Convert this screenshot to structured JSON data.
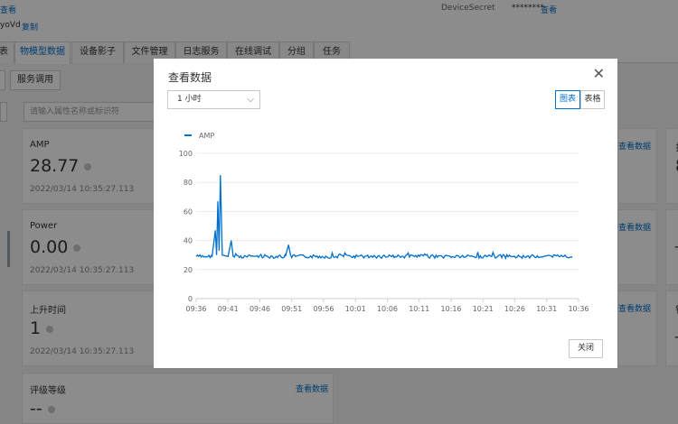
{
  "background": {
    "top": {
      "view_link_left": "查看",
      "device_name_suffix": "yoVd",
      "copy_link": "复制",
      "secret_label": "DeviceSecret",
      "secret_mask": "********",
      "secret_view_link": "查看"
    },
    "tabs": [
      "表",
      "物模型数据",
      "设备影子",
      "文件管理",
      "日志服务",
      "在线调试",
      "分组",
      "任务"
    ],
    "sub_button": "服务调用",
    "search_placeholder": "请输入属性名称或标识符",
    "cards": [
      {
        "name": "AMP",
        "value": "28.77",
        "time": "2022/03/14 10:35:27.113"
      },
      {
        "name": "Power",
        "value": "0.00",
        "time": "2022/03/14 10:35:27.113"
      },
      {
        "name": "上升时间",
        "value": "1",
        "time": "2022/03/14 10:35:27.113"
      },
      {
        "name": "评级等级",
        "value": "--",
        "time": ""
      }
    ],
    "view_data_link": "查看数据",
    "right_cards_partial": [
      "扌",
      "8",
      "",
      "_",
      "",
      "钅",
      "_"
    ]
  },
  "dialog": {
    "title": "查看数据",
    "time_range": "1 小时",
    "view_chart": "图表",
    "view_table": "表格",
    "close_button": "关闭"
  },
  "chart_data": {
    "type": "line",
    "series": [
      {
        "name": "AMP",
        "color": "#0070cc"
      }
    ],
    "ylim": [
      0,
      100
    ],
    "yticks": [
      0,
      20,
      40,
      60,
      80,
      100
    ],
    "xticks": [
      "09:36",
      "09:41",
      "09:46",
      "09:51",
      "09:56",
      "10:01",
      "10:06",
      "10:11",
      "10:16",
      "10:21",
      "10:26",
      "10:31",
      "10:36"
    ],
    "baseline": 29,
    "points": [
      {
        "t": "09:36.0",
        "v": 29
      },
      {
        "t": "09:38.5",
        "v": 29
      },
      {
        "t": "09:39.0",
        "v": 47
      },
      {
        "t": "09:39.2",
        "v": 30
      },
      {
        "t": "09:39.4",
        "v": 67
      },
      {
        "t": "09:39.6",
        "v": 33
      },
      {
        "t": "09:39.8",
        "v": 85
      },
      {
        "t": "09:40.1",
        "v": 30
      },
      {
        "t": "09:41.0",
        "v": 29
      },
      {
        "t": "09:41.5",
        "v": 40
      },
      {
        "t": "09:41.8",
        "v": 29
      },
      {
        "t": "09:50.0",
        "v": 29
      },
      {
        "t": "09:50.5",
        "v": 37
      },
      {
        "t": "09:50.8",
        "v": 29
      },
      {
        "t": "10:35.0",
        "v": 29
      }
    ],
    "x_start": "09:36",
    "x_end": "10:36",
    "grid": true,
    "legend": "top-left"
  }
}
